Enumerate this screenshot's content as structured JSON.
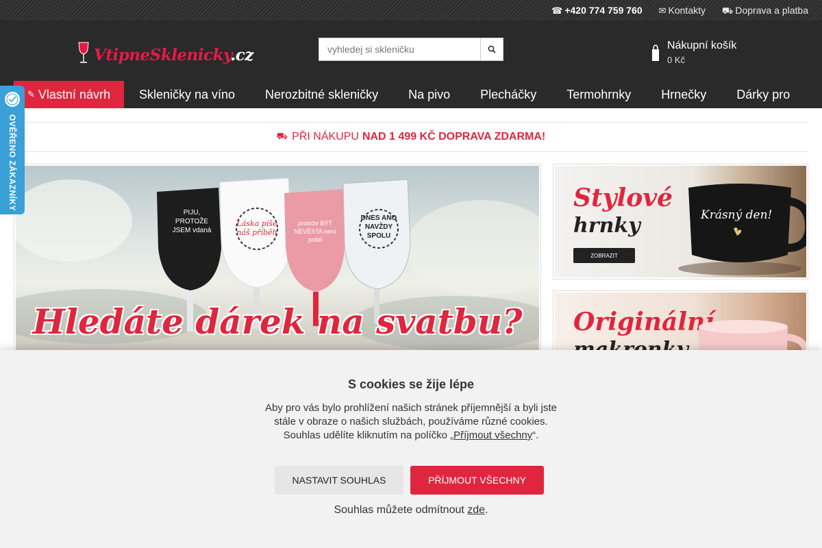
{
  "topbar": {
    "phone_icon": "phone-icon",
    "phone": "+420 774 759 760",
    "contacts_icon": "envelope-icon",
    "contacts": "Kontakty",
    "shipping_icon": "truck-icon",
    "shipping": "Doprava a platba"
  },
  "header": {
    "logo_part1": "VtipneSklenicky",
    "logo_part2": ".cz",
    "search_placeholder": "vyhledej si skleničku",
    "cart_title": "Nákupní košík",
    "cart_price": "0 Kč"
  },
  "nav": {
    "items": [
      {
        "label": "Vlastní návrh",
        "icon": "pencil-icon"
      },
      {
        "label": "Skleničky na víno"
      },
      {
        "label": "Nerozbitné skleničky"
      },
      {
        "label": "Na pivo"
      },
      {
        "label": "Plecháčky"
      },
      {
        "label": "Termohrnky"
      },
      {
        "label": "Hrnečky"
      },
      {
        "label": "Dárky pro"
      }
    ]
  },
  "shipping_banner": {
    "prefix": "PŘI NÁKUPU",
    "highlight": "NAD 1 499 KČ DOPRAVA ZDARMA!"
  },
  "main_banner": {
    "headline": "Hledáte dárek na svatbu?",
    "glass_texts": [
      "PIJU, PROTOŽE JSEM vdaná",
      "Láska píše náš příběh",
      "protože BÝT NEVĚSTA není prdel",
      "DNES ANO NAVŽDY SPOLU"
    ]
  },
  "side_banner_1": {
    "title": "Stylové",
    "subtitle": "hrnky",
    "button": "ZOBRAZIT",
    "mug_text": "Krásný den!"
  },
  "side_banner_2": {
    "title": "Originální",
    "subtitle": "makronky"
  },
  "verified_badge": {
    "label": "OVĚŘENO ZÁKAZNÍKY"
  },
  "cookie": {
    "title": "S cookies se žije lépe",
    "text_before": "Aby pro vás bylo prohlížení našich stránek příjemnější a byli jste stále v obraze o našich službách, používáme různé cookies. Souhlas udělíte kliknutím na políčko „",
    "text_link": "Příjmout všechny",
    "text_after": "“.",
    "btn_settings": "NASTAVIT SOUHLAS",
    "btn_accept": "PŘÍJMOUT VŠECHNY",
    "refuse_before": "Souhlas můžete odmítnout ",
    "refuse_link": "zde",
    "refuse_after": "."
  },
  "colors": {
    "accent": "#e0263e",
    "header_bg": "#2a2a2a",
    "badge": "#3b9fd8"
  }
}
